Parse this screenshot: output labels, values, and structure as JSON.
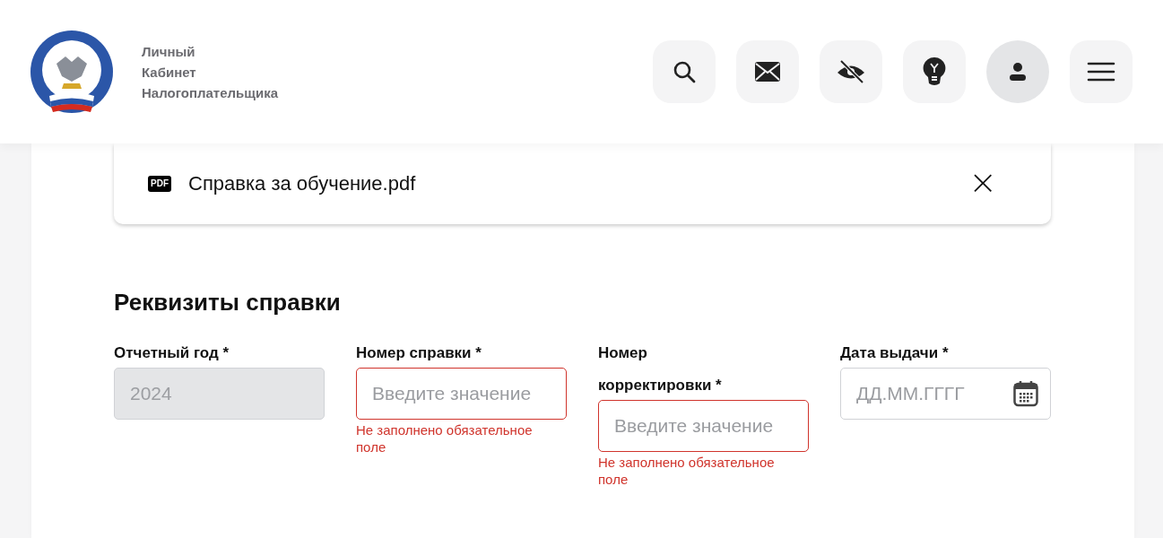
{
  "header": {
    "title_lines": [
      "Личный",
      "Кабинет",
      "Налогоплательщика"
    ],
    "actions": [
      {
        "kind": "search"
      },
      {
        "kind": "mail"
      },
      {
        "kind": "accessibility"
      },
      {
        "kind": "tips"
      },
      {
        "kind": "profile"
      },
      {
        "kind": "menu"
      }
    ]
  },
  "attachment": {
    "badge": "PDF",
    "file_name": "Справка за обучение.pdf",
    "close": "×"
  },
  "section_title": "Реквизиты справки",
  "fields": [
    {
      "kind": "text",
      "label": "Отчетный год *",
      "value": "2024",
      "disabled": true
    },
    {
      "kind": "text",
      "label": "Номер справки *",
      "placeholder": "Введите значение",
      "disabled": false,
      "error": "Не заполнено обязательное поле"
    },
    {
      "kind": "text",
      "label": "Номер корректировки *",
      "placeholder": "Введите значение",
      "disabled": false,
      "error": "Не заполнено обязательное поле"
    },
    {
      "kind": "date",
      "label": "Дата выдачи *",
      "placeholder": "ДД.ММ.ГГГГ",
      "disabled": false
    }
  ]
}
